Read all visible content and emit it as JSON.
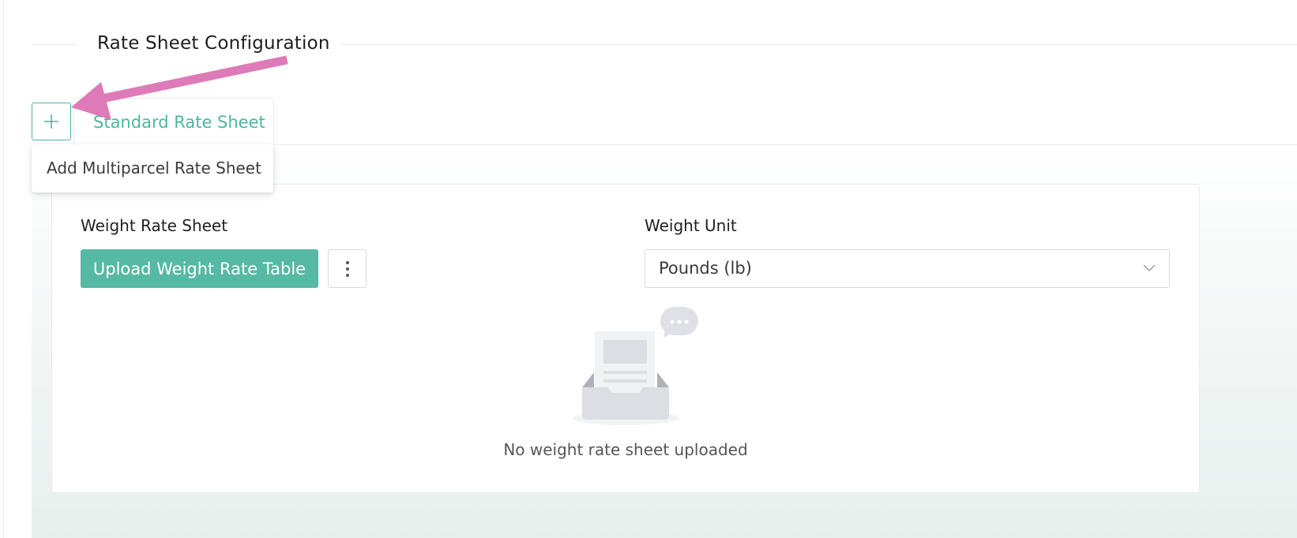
{
  "section": {
    "title": "Rate Sheet Configuration"
  },
  "tabs": {
    "add_button_icon": "plus-icon",
    "items": [
      {
        "label": "Standard Rate Sheet",
        "active": true
      }
    ]
  },
  "dropdown": {
    "items": [
      {
        "label": "Add Multiparcel Rate Sheet"
      }
    ]
  },
  "weight_rate_sheet": {
    "label": "Weight Rate Sheet",
    "upload_button_label": "Upload Weight Rate Table",
    "more_icon": "more-vertical-icon"
  },
  "weight_unit": {
    "label": "Weight Unit",
    "selected": "Pounds (lb)",
    "chevron_icon": "chevron-down-icon"
  },
  "empty_state": {
    "icon": "empty-inbox-icon",
    "message": "No weight rate sheet uploaded"
  },
  "annotation": {
    "icon": "arrow-icon",
    "color": "#de7ab7"
  },
  "colors": {
    "accent": "#56b9a3",
    "accent_text": "#4ab7a0"
  }
}
